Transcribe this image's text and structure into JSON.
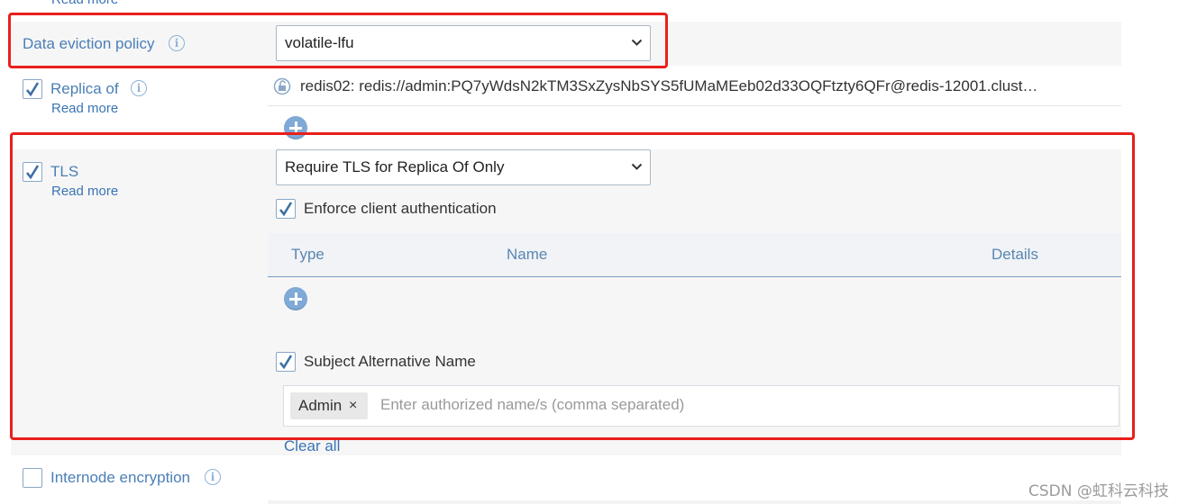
{
  "top": {
    "read_more_cut": "Read more"
  },
  "eviction": {
    "label": "Data eviction policy",
    "value": "volatile-lfu"
  },
  "replica_of": {
    "label": "Replica of",
    "checked": true,
    "read_more": "Read more",
    "entry": "redis02: redis://admin:PQ7yWdsN2kTM3SxZysNbSYS5fUMaMEeb02d33OQFtzty6QFr@redis-12001.clust…"
  },
  "tls": {
    "label": "TLS",
    "checked": true,
    "read_more": "Read more",
    "mode_value": "Require TLS for Replica Of Only",
    "enforce_client_auth": "Enforce client authentication",
    "table": {
      "col_type": "Type",
      "col_name": "Name",
      "col_details": "Details"
    },
    "san_label": "Subject Alternative Name",
    "san_tags": [
      "Admin"
    ],
    "san_placeholder": "Enter authorized name/s (comma separated)",
    "clear_all": "Clear all"
  },
  "internode": {
    "label": "Internode encryption",
    "checked": false
  },
  "watermark": "CSDN @虹科云科技",
  "colors": {
    "accent": "#4a7fb5",
    "highlight_border": "#e8201c",
    "band": "#f6f6f6"
  }
}
